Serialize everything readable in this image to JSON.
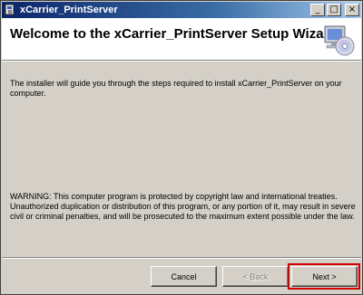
{
  "window": {
    "title": "xCarrier_PrintServer",
    "controls": {
      "minimize": "_",
      "maximize": "□",
      "close": "×"
    }
  },
  "banner": {
    "title": "Welcome to the xCarrier_PrintServer Setup Wizard",
    "icon": "computer-cd-icon"
  },
  "body": {
    "intro": "The installer will guide you through the steps required to install xCarrier_PrintServer on your computer.",
    "warning": "WARNING: This computer program is protected by copyright law and international treaties. Unauthorized duplication or distribution of this program, or any portion of it, may result in severe civil or criminal penalties, and will be prosecuted to the maximum extent possible under the law."
  },
  "buttons": {
    "cancel": "Cancel",
    "back": "< Back",
    "next": "Next >"
  },
  "colors": {
    "titlebar_start": "#0a246a",
    "titlebar_end": "#a6caf0",
    "highlight": "#d00000",
    "face": "#d4d0c8"
  }
}
